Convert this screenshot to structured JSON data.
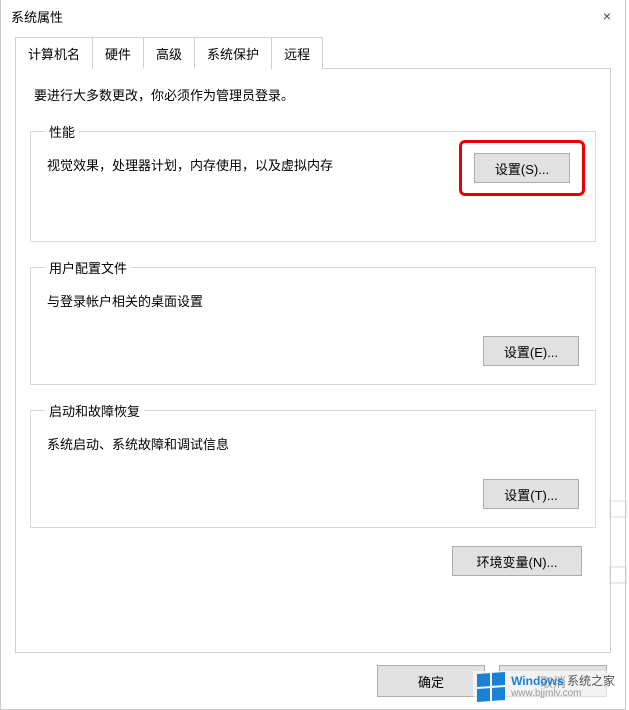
{
  "window": {
    "title": "系统属性",
    "close_label": "×"
  },
  "tabs": {
    "computer_name": "计算机名",
    "hardware": "硬件",
    "advanced": "高级",
    "system_protection": "系统保护",
    "remote": "远程"
  },
  "panel": {
    "admin_note": "要进行大多数更改，你必须作为管理员登录。",
    "performance": {
      "legend": "性能",
      "desc": "视觉效果，处理器计划，内存使用，以及虚拟内存",
      "settings_btn": "设置(S)..."
    },
    "user_profile": {
      "legend": "用户配置文件",
      "desc": "与登录帐户相关的桌面设置",
      "settings_btn": "设置(E)..."
    },
    "startup": {
      "legend": "启动和故障恢复",
      "desc": "系统启动、系统故障和调试信息",
      "settings_btn": "设置(T)..."
    },
    "env_btn": "环境变量(N)..."
  },
  "buttons": {
    "ok": "确定",
    "cancel": "取消"
  },
  "watermark": {
    "brand": "Windows",
    "suffix": "系统之家",
    "url": "www.bjjmlv.com"
  }
}
